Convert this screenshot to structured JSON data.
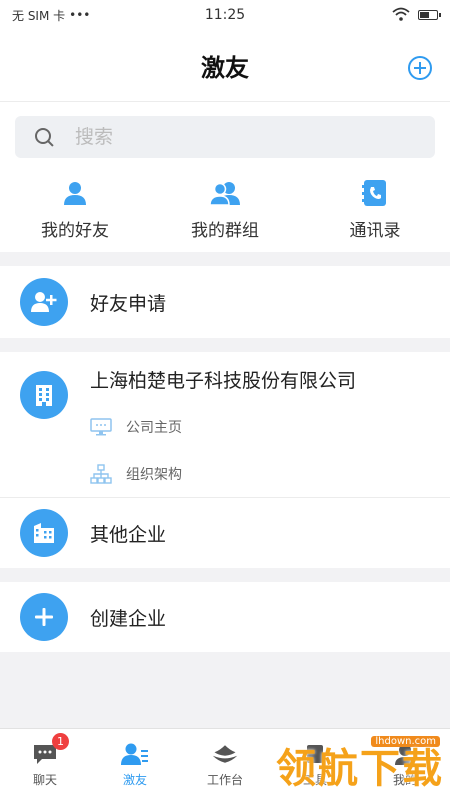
{
  "status_bar": {
    "carrier": "无 SIM 卡",
    "signal_dots": "•••",
    "time": "11:25"
  },
  "header": {
    "title": "激友"
  },
  "search": {
    "placeholder": "搜索"
  },
  "quick_actions": [
    {
      "label": "我的好友",
      "icon": "person-icon"
    },
    {
      "label": "我的群组",
      "icon": "group-icon"
    },
    {
      "label": "通讯录",
      "icon": "phone-book-icon"
    }
  ],
  "friend_request": {
    "label": "好友申请",
    "icon": "add-person-icon"
  },
  "company": {
    "name": "上海柏楚电子科技股份有限公司",
    "icon": "building-icon",
    "sub_items": [
      {
        "label": "公司主页",
        "icon": "monitor-icon"
      },
      {
        "label": "组织架构",
        "icon": "org-chart-icon"
      }
    ]
  },
  "other_enterprise": {
    "label": "其他企业",
    "icon": "buildings-icon"
  },
  "create_enterprise": {
    "label": "创建企业",
    "icon": "plus-icon"
  },
  "tabs": [
    {
      "label": "聊天",
      "icon": "chat-icon",
      "badge": "1",
      "active": false
    },
    {
      "label": "激友",
      "icon": "contacts-icon",
      "active": true
    },
    {
      "label": "工作台",
      "icon": "workbench-icon",
      "active": false
    },
    {
      "label": "工具",
      "icon": "tool-icon",
      "active": false
    },
    {
      "label": "我的",
      "icon": "me-icon",
      "active": false
    }
  ],
  "watermark": {
    "url": "lhdown.com",
    "text": "领航下载"
  },
  "colors": {
    "accent": "#3ea2f0",
    "badge": "#ef3f3f",
    "background": "#f2f2f4"
  }
}
